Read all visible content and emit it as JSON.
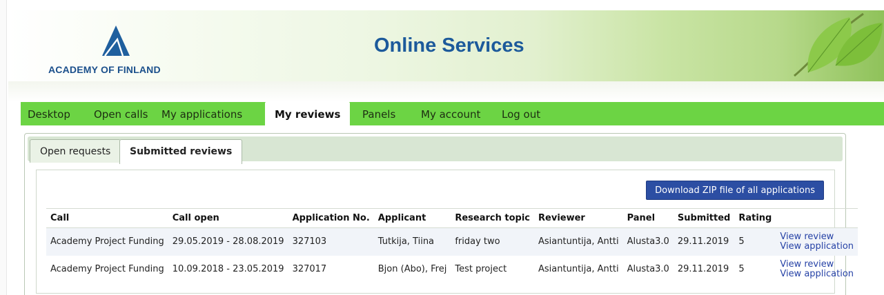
{
  "header": {
    "logo_text": "ACADEMY OF FINLAND",
    "site_title": "Online Services"
  },
  "nav": {
    "items": [
      {
        "label": "Desktop"
      },
      {
        "label": "Open calls"
      },
      {
        "label": "My applications"
      },
      {
        "label": "My reviews",
        "active": true
      },
      {
        "label": "Panels"
      },
      {
        "label": "My account"
      },
      {
        "label": "Log out"
      }
    ]
  },
  "tabs": [
    {
      "label": "Open requests"
    },
    {
      "label": "Submitted reviews",
      "active": true
    }
  ],
  "download_button": "Download ZIP file of all applications",
  "table": {
    "columns": [
      "Call",
      "Call open",
      "Application No.",
      "Applicant",
      "Research topic",
      "Reviewer",
      "Panel",
      "Submitted",
      "Rating",
      ""
    ],
    "rows": [
      {
        "call": "Academy Project Funding",
        "call_open": "29.05.2019 - 28.08.2019",
        "application_no": "327103",
        "applicant": "Tutkija, Tiina",
        "research_topic": "friday two",
        "reviewer": "Asiantuntija, Antti",
        "panel": "Alusta3.0",
        "submitted": "29.11.2019",
        "rating": "5",
        "view_review": "View review",
        "view_application": "View application"
      },
      {
        "call": "Academy Project Funding",
        "call_open": "10.09.2018 - 23.05.2019",
        "application_no": "327017",
        "applicant": "Bjon (Abo), Frej",
        "research_topic": "Test project",
        "reviewer": "Asiantuntija, Antti",
        "panel": "Alusta3.0",
        "submitted": "29.11.2019",
        "rating": "5",
        "view_review": "View review",
        "view_application": "View application"
      }
    ]
  },
  "colors": {
    "nav_green": "#6cd444",
    "title_blue": "#1c5a9b",
    "button_blue": "#2c4ea3",
    "link_blue": "#2642a6"
  }
}
